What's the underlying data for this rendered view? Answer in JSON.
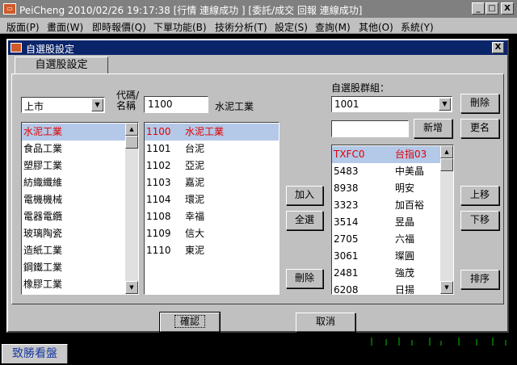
{
  "app": {
    "title": "PeiCheng  2010/02/26 19:17:38  [行情  連線成功 ] [委託/成交 回報  連線成功]",
    "minimize": "_",
    "maximize": "□",
    "close": "X"
  },
  "menu": [
    "版面(P)",
    "畫面(W)",
    "即時報價(Q)",
    "下單功能(B)",
    "技術分析(T)",
    "設定(S)",
    "查詢(M)",
    "其他(O)",
    "系統(Y)"
  ],
  "dialog": {
    "title": "自選股設定",
    "close": "X",
    "tab": "自選股設定",
    "market_select": "上市",
    "code_label_1": "代碼/",
    "code_label_2": "名稱",
    "code_input": "1100",
    "code_name": "水泥工業",
    "group_label": "自選股群組：",
    "group_select": "1001",
    "new_group_input": "",
    "buttons": {
      "delete_group": "刪除",
      "new": "新增",
      "rename": "更名",
      "add": "加入",
      "select_all": "全選",
      "remove": "刪除",
      "move_up": "上移",
      "move_down": "下移",
      "sort": "排序",
      "ok": "確認",
      "cancel": "取消"
    },
    "categories": [
      "水泥工業",
      "食品工業",
      "塑膠工業",
      "紡織纖維",
      "電機機械",
      "電器電纜",
      "玻璃陶瓷",
      "造紙工業",
      "鋼鐵工業",
      "橡膠工業"
    ],
    "stocks": [
      {
        "code": "1100",
        "name": "水泥工業"
      },
      {
        "code": "1101",
        "name": "台泥"
      },
      {
        "code": "1102",
        "name": "亞泥"
      },
      {
        "code": "1103",
        "name": "嘉泥"
      },
      {
        "code": "1104",
        "name": "環泥"
      },
      {
        "code": "1108",
        "name": "幸福"
      },
      {
        "code": "1109",
        "name": "信大"
      },
      {
        "code": "1110",
        "name": "東泥"
      }
    ],
    "watchlist": [
      {
        "code": "TXFC0",
        "name": "台指03"
      },
      {
        "code": "5483",
        "name": "中美晶"
      },
      {
        "code": "8938",
        "name": "明安"
      },
      {
        "code": "3323",
        "name": "加百裕"
      },
      {
        "code": "3514",
        "name": "昱晶"
      },
      {
        "code": "2705",
        "name": "六福"
      },
      {
        "code": "3061",
        "name": "璨圓"
      },
      {
        "code": "2481",
        "name": "強茂"
      },
      {
        "code": "6208",
        "name": "日揚"
      }
    ]
  },
  "brand": "致勝看盤",
  "colors": {
    "selection_bg": "#b4c8e8",
    "selection_fg": "#e00000",
    "dialog_title_bg": "#0a246a",
    "brand_text": "#1a3aa0"
  }
}
